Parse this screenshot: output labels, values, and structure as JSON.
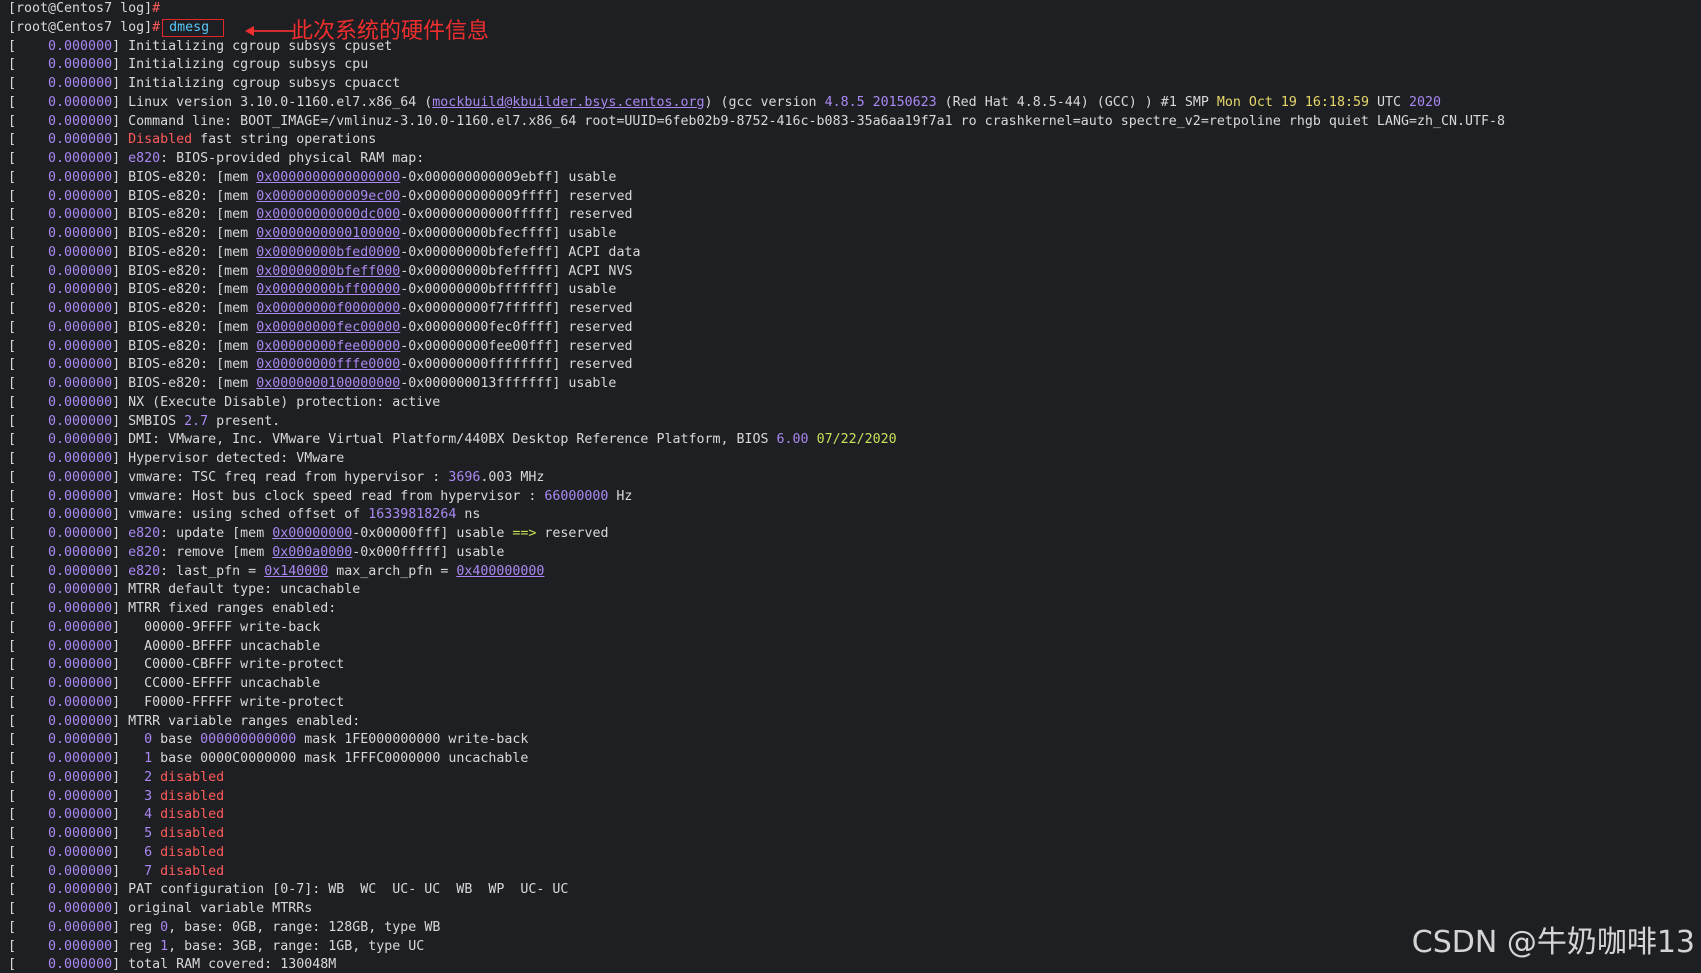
{
  "prompt": {
    "line1": "[root@Centos7 log]",
    "line1_hash": "#",
    "line2": "[root@Centos7 log]",
    "line2_hash": "#",
    "command": "dmesg"
  },
  "annotation": "此次系统的硬件信息",
  "watermark": "CSDN @牛奶咖啡13",
  "colors": {
    "background": "#1e1f22",
    "text": "#d8d8d8",
    "number": "#a988f2",
    "red": "#ff5b5b",
    "green": "#c4e257",
    "yellow": "#e6d86a",
    "command": "#57c5f7",
    "annotation": "#ef2e2e"
  },
  "lines": [
    [
      [
        "w",
        "[    "
      ],
      [
        "n",
        "0.000000"
      ],
      [
        "w",
        "] Initializing cgroup subsys cpuset"
      ]
    ],
    [
      [
        "w",
        "[    "
      ],
      [
        "n",
        "0.000000"
      ],
      [
        "w",
        "] Initializing cgroup subsys cpu"
      ]
    ],
    [
      [
        "w",
        "[    "
      ],
      [
        "n",
        "0.000000"
      ],
      [
        "w",
        "] Initializing cgroup subsys cpuacct"
      ]
    ],
    [
      [
        "w",
        "[    "
      ],
      [
        "n",
        "0.000000"
      ],
      [
        "w",
        "] Linux version 3.10.0-1160.el7.x86_64 ("
      ],
      [
        "l",
        "mockbuild@kbuilder.bsys.centos.org"
      ],
      [
        "w",
        ") (gcc version "
      ],
      [
        "n",
        "4.8.5 20150623"
      ],
      [
        "w",
        " (Red Hat 4.8.5-44) (GCC) ) #1 SMP "
      ],
      [
        "y",
        "Mon Oct 19 16:18:59"
      ],
      [
        "w",
        " UTC "
      ],
      [
        "n",
        "2020"
      ]
    ],
    [
      [
        "w",
        "[    "
      ],
      [
        "n",
        "0.000000"
      ],
      [
        "w",
        "] Command line: BOOT_IMAGE=/vmlinuz-3.10.0-1160.el7.x86_64 root=UUID=6feb02b9-8752-416c-b083-35a6aa19f7a1 ro crashkernel=auto spectre_v2=retpoline rhgb quiet LANG=zh_CN.UTF-8"
      ]
    ],
    [
      [
        "w",
        "[    "
      ],
      [
        "n",
        "0.000000"
      ],
      [
        "w",
        "] "
      ],
      [
        "r",
        "Disabled"
      ],
      [
        "w",
        " fast string operations"
      ]
    ],
    [
      [
        "w",
        "[    "
      ],
      [
        "n",
        "0.000000"
      ],
      [
        "w",
        "] "
      ],
      [
        "n",
        "e820"
      ],
      [
        "w",
        ": BIOS-provided physical RAM map:"
      ]
    ],
    [
      [
        "w",
        "[    "
      ],
      [
        "n",
        "0.000000"
      ],
      [
        "w",
        "] BIOS-e820: [mem "
      ],
      [
        "l",
        "0x0000000000000000"
      ],
      [
        "w",
        "-0x000000000009ebff] usable"
      ]
    ],
    [
      [
        "w",
        "[    "
      ],
      [
        "n",
        "0.000000"
      ],
      [
        "w",
        "] BIOS-e820: [mem "
      ],
      [
        "l",
        "0x000000000009ec00"
      ],
      [
        "w",
        "-0x000000000009ffff] reserved"
      ]
    ],
    [
      [
        "w",
        "[    "
      ],
      [
        "n",
        "0.000000"
      ],
      [
        "w",
        "] BIOS-e820: [mem "
      ],
      [
        "l",
        "0x00000000000dc000"
      ],
      [
        "w",
        "-0x00000000000fffff] reserved"
      ]
    ],
    [
      [
        "w",
        "[    "
      ],
      [
        "n",
        "0.000000"
      ],
      [
        "w",
        "] BIOS-e820: [mem "
      ],
      [
        "l",
        "0x0000000000100000"
      ],
      [
        "w",
        "-0x00000000bfecffff] usable"
      ]
    ],
    [
      [
        "w",
        "[    "
      ],
      [
        "n",
        "0.000000"
      ],
      [
        "w",
        "] BIOS-e820: [mem "
      ],
      [
        "l",
        "0x00000000bfed0000"
      ],
      [
        "w",
        "-0x00000000bfefefff] ACPI data"
      ]
    ],
    [
      [
        "w",
        "[    "
      ],
      [
        "n",
        "0.000000"
      ],
      [
        "w",
        "] BIOS-e820: [mem "
      ],
      [
        "l",
        "0x00000000bfeff000"
      ],
      [
        "w",
        "-0x00000000bfefffff] ACPI NVS"
      ]
    ],
    [
      [
        "w",
        "[    "
      ],
      [
        "n",
        "0.000000"
      ],
      [
        "w",
        "] BIOS-e820: [mem "
      ],
      [
        "l",
        "0x00000000bff00000"
      ],
      [
        "w",
        "-0x00000000bfffffff] usable"
      ]
    ],
    [
      [
        "w",
        "[    "
      ],
      [
        "n",
        "0.000000"
      ],
      [
        "w",
        "] BIOS-e820: [mem "
      ],
      [
        "l",
        "0x00000000f0000000"
      ],
      [
        "w",
        "-0x00000000f7ffffff] reserved"
      ]
    ],
    [
      [
        "w",
        "[    "
      ],
      [
        "n",
        "0.000000"
      ],
      [
        "w",
        "] BIOS-e820: [mem "
      ],
      [
        "l",
        "0x00000000fec00000"
      ],
      [
        "w",
        "-0x00000000fec0ffff] reserved"
      ]
    ],
    [
      [
        "w",
        "[    "
      ],
      [
        "n",
        "0.000000"
      ],
      [
        "w",
        "] BIOS-e820: [mem "
      ],
      [
        "l",
        "0x00000000fee00000"
      ],
      [
        "w",
        "-0x00000000fee00fff] reserved"
      ]
    ],
    [
      [
        "w",
        "[    "
      ],
      [
        "n",
        "0.000000"
      ],
      [
        "w",
        "] BIOS-e820: [mem "
      ],
      [
        "l",
        "0x00000000fffe0000"
      ],
      [
        "w",
        "-0x00000000ffffffff] reserved"
      ]
    ],
    [
      [
        "w",
        "[    "
      ],
      [
        "n",
        "0.000000"
      ],
      [
        "w",
        "] BIOS-e820: [mem "
      ],
      [
        "l",
        "0x0000000100000000"
      ],
      [
        "w",
        "-0x000000013fffffff] usable"
      ]
    ],
    [
      [
        "w",
        "[    "
      ],
      [
        "n",
        "0.000000"
      ],
      [
        "w",
        "] NX (Execute Disable) protection: active"
      ]
    ],
    [
      [
        "w",
        "[    "
      ],
      [
        "n",
        "0.000000"
      ],
      [
        "w",
        "] SMBIOS "
      ],
      [
        "n",
        "2.7"
      ],
      [
        "w",
        " present."
      ]
    ],
    [
      [
        "w",
        "[    "
      ],
      [
        "n",
        "0.000000"
      ],
      [
        "w",
        "] DMI: VMware, Inc. VMware Virtual Platform/440BX Desktop Reference Platform, BIOS "
      ],
      [
        "n",
        "6.00"
      ],
      [
        "w",
        " "
      ],
      [
        "g",
        "07/22/2020"
      ]
    ],
    [
      [
        "w",
        "[    "
      ],
      [
        "n",
        "0.000000"
      ],
      [
        "w",
        "] Hypervisor detected: VMware"
      ]
    ],
    [
      [
        "w",
        "[    "
      ],
      [
        "n",
        "0.000000"
      ],
      [
        "w",
        "] vmware: TSC freq read from hypervisor : "
      ],
      [
        "n",
        "3696"
      ],
      [
        "w",
        ".003 MHz"
      ]
    ],
    [
      [
        "w",
        "[    "
      ],
      [
        "n",
        "0.000000"
      ],
      [
        "w",
        "] vmware: Host bus clock speed read from hypervisor : "
      ],
      [
        "n",
        "66000000"
      ],
      [
        "w",
        " Hz"
      ]
    ],
    [
      [
        "w",
        "[    "
      ],
      [
        "n",
        "0.000000"
      ],
      [
        "w",
        "] vmware: using sched offset of "
      ],
      [
        "n",
        "16339818264"
      ],
      [
        "w",
        " ns"
      ]
    ],
    [
      [
        "w",
        "[    "
      ],
      [
        "n",
        "0.000000"
      ],
      [
        "w",
        "] "
      ],
      [
        "n",
        "e820"
      ],
      [
        "w",
        ": update [mem "
      ],
      [
        "l",
        "0x00000000"
      ],
      [
        "w",
        "-0x00000fff] usable "
      ],
      [
        "g",
        "==>"
      ],
      [
        "w",
        " reserved"
      ]
    ],
    [
      [
        "w",
        "[    "
      ],
      [
        "n",
        "0.000000"
      ],
      [
        "w",
        "] "
      ],
      [
        "n",
        "e820"
      ],
      [
        "w",
        ": remove [mem "
      ],
      [
        "l",
        "0x000a0000"
      ],
      [
        "w",
        "-0x000fffff] usable"
      ]
    ],
    [
      [
        "w",
        "[    "
      ],
      [
        "n",
        "0.000000"
      ],
      [
        "w",
        "] "
      ],
      [
        "n",
        "e820"
      ],
      [
        "w",
        ": last_pfn = "
      ],
      [
        "l",
        "0x140000"
      ],
      [
        "w",
        " max_arch_pfn = "
      ],
      [
        "l",
        "0x400000000"
      ]
    ],
    [
      [
        "w",
        "[    "
      ],
      [
        "n",
        "0.000000"
      ],
      [
        "w",
        "] MTRR default type: uncachable"
      ]
    ],
    [
      [
        "w",
        "[    "
      ],
      [
        "n",
        "0.000000"
      ],
      [
        "w",
        "] MTRR fixed ranges enabled:"
      ]
    ],
    [
      [
        "w",
        "[    "
      ],
      [
        "n",
        "0.000000"
      ],
      [
        "w",
        "]   00000-9FFFF write-back"
      ]
    ],
    [
      [
        "w",
        "[    "
      ],
      [
        "n",
        "0.000000"
      ],
      [
        "w",
        "]   A0000-BFFFF uncachable"
      ]
    ],
    [
      [
        "w",
        "[    "
      ],
      [
        "n",
        "0.000000"
      ],
      [
        "w",
        "]   C0000-CBFFF write-protect"
      ]
    ],
    [
      [
        "w",
        "[    "
      ],
      [
        "n",
        "0.000000"
      ],
      [
        "w",
        "]   CC000-EFFFF uncachable"
      ]
    ],
    [
      [
        "w",
        "[    "
      ],
      [
        "n",
        "0.000000"
      ],
      [
        "w",
        "]   F0000-FFFFF write-protect"
      ]
    ],
    [
      [
        "w",
        "[    "
      ],
      [
        "n",
        "0.000000"
      ],
      [
        "w",
        "] MTRR variable ranges enabled:"
      ]
    ],
    [
      [
        "w",
        "[    "
      ],
      [
        "n",
        "0.000000"
      ],
      [
        "w",
        "]   "
      ],
      [
        "n",
        "0"
      ],
      [
        "w",
        " base "
      ],
      [
        "n",
        "000000000000"
      ],
      [
        "w",
        " mask 1FE000000000 write-back"
      ]
    ],
    [
      [
        "w",
        "[    "
      ],
      [
        "n",
        "0.000000"
      ],
      [
        "w",
        "]   "
      ],
      [
        "n",
        "1"
      ],
      [
        "w",
        " base 0000C0000000 mask 1FFFC0000000 uncachable"
      ]
    ],
    [
      [
        "w",
        "[    "
      ],
      [
        "n",
        "0.000000"
      ],
      [
        "w",
        "]   "
      ],
      [
        "n",
        "2"
      ],
      [
        "w",
        " "
      ],
      [
        "r",
        "disabled"
      ]
    ],
    [
      [
        "w",
        "[    "
      ],
      [
        "n",
        "0.000000"
      ],
      [
        "w",
        "]   "
      ],
      [
        "n",
        "3"
      ],
      [
        "w",
        " "
      ],
      [
        "r",
        "disabled"
      ]
    ],
    [
      [
        "w",
        "[    "
      ],
      [
        "n",
        "0.000000"
      ],
      [
        "w",
        "]   "
      ],
      [
        "n",
        "4"
      ],
      [
        "w",
        " "
      ],
      [
        "r",
        "disabled"
      ]
    ],
    [
      [
        "w",
        "[    "
      ],
      [
        "n",
        "0.000000"
      ],
      [
        "w",
        "]   "
      ],
      [
        "n",
        "5"
      ],
      [
        "w",
        " "
      ],
      [
        "r",
        "disabled"
      ]
    ],
    [
      [
        "w",
        "[    "
      ],
      [
        "n",
        "0.000000"
      ],
      [
        "w",
        "]   "
      ],
      [
        "n",
        "6"
      ],
      [
        "w",
        " "
      ],
      [
        "r",
        "disabled"
      ]
    ],
    [
      [
        "w",
        "[    "
      ],
      [
        "n",
        "0.000000"
      ],
      [
        "w",
        "]   "
      ],
      [
        "n",
        "7"
      ],
      [
        "w",
        " "
      ],
      [
        "r",
        "disabled"
      ]
    ],
    [
      [
        "w",
        "[    "
      ],
      [
        "n",
        "0.000000"
      ],
      [
        "w",
        "] PAT configuration [0-7]: WB  WC  UC- UC  WB  WP  UC- UC"
      ]
    ],
    [
      [
        "w",
        "[    "
      ],
      [
        "n",
        "0.000000"
      ],
      [
        "w",
        "] original variable MTRRs"
      ]
    ],
    [
      [
        "w",
        "[    "
      ],
      [
        "n",
        "0.000000"
      ],
      [
        "w",
        "] reg "
      ],
      [
        "n",
        "0"
      ],
      [
        "w",
        ", base: 0GB, range: 128GB, type WB"
      ]
    ],
    [
      [
        "w",
        "[    "
      ],
      [
        "n",
        "0.000000"
      ],
      [
        "w",
        "] reg "
      ],
      [
        "n",
        "1"
      ],
      [
        "w",
        ", base: 3GB, range: 1GB, type UC"
      ]
    ],
    [
      [
        "w",
        "[    "
      ],
      [
        "n",
        "0.000000"
      ],
      [
        "w",
        "] total RAM covered: 130048M"
      ]
    ]
  ]
}
